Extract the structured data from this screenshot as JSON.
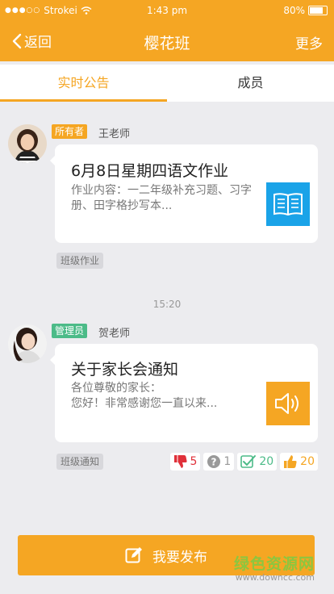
{
  "status_bar": {
    "carrier": "Strokei",
    "time": "1:43 pm",
    "battery": "80%",
    "battery_level": 0.8
  },
  "nav": {
    "back_label": "返回",
    "title": "樱花班",
    "more_label": "更多"
  },
  "tabs": [
    {
      "label": "实时公告",
      "active": true
    },
    {
      "label": "成员",
      "active": false
    }
  ],
  "posts": [
    {
      "role": "所有者",
      "role_color": "#f5a623",
      "author": "王老师",
      "title": "6月8日星期四语文作业",
      "body": "作业内容：一二年级补充习题、习字册、田字格抄写本...",
      "icon": "book-icon",
      "icon_color": "#1aa3e8",
      "tag": "班级作业"
    },
    {
      "role": "管理员",
      "role_color": "#4cbb88",
      "author": "贺老师",
      "title": "关于家长会通知",
      "body": "各位尊敬的家长：\n您好！非常感谢您一直以来...",
      "icon": "speaker-icon",
      "icon_color": "#f5a623",
      "tag": "班级通知",
      "reactions": [
        {
          "icon": "thumbs-down-icon",
          "count": "5",
          "color": "#e0303a"
        },
        {
          "icon": "question-icon",
          "count": "1",
          "color": "#999999"
        },
        {
          "icon": "check-icon",
          "count": "20",
          "color": "#4cbb88"
        },
        {
          "icon": "thumbs-up-icon",
          "count": "20",
          "color": "#f5a623"
        }
      ]
    }
  ],
  "timestamp": "15:20",
  "publish_label": "我要发布",
  "watermark": {
    "name": "绿色资源网",
    "url": "www.downcc.com"
  },
  "colors": {
    "accent": "#f5a623",
    "background": "#ececef"
  }
}
